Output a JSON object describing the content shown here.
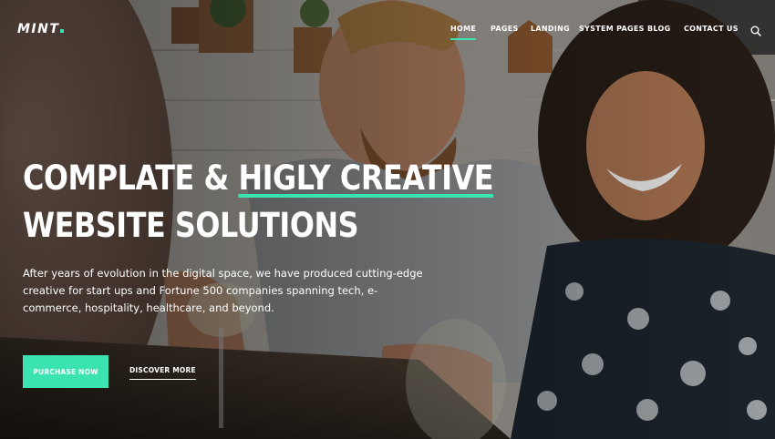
{
  "brand": {
    "logo_text": "MINT",
    "accent_color": "#3be3b0"
  },
  "nav": {
    "items": [
      {
        "label": "HOME",
        "active": true
      },
      {
        "label": "PAGES",
        "active": false
      },
      {
        "label": "LANDING",
        "active": false
      },
      {
        "label": "SYSTEM PAGES",
        "active": false
      },
      {
        "label": "BLOG",
        "active": false
      },
      {
        "label": "CONTACT US",
        "active": false
      }
    ],
    "search_icon": "search-icon"
  },
  "hero": {
    "headline_line1_pre": "COMPLATE & ",
    "headline_line1_highlight": "HIGLY CREATIVE",
    "headline_line2": "WEBSITE SOLUTIONS",
    "description": "After years of evolution in the digital space, we have produced cutting-edge creative for start ups and Fortune 500 companies spanning tech, e-commerce, hospitality, healthcare, and beyond.",
    "primary_button": "PURCHASE NOW",
    "secondary_button": "DISCOVER MORE"
  }
}
